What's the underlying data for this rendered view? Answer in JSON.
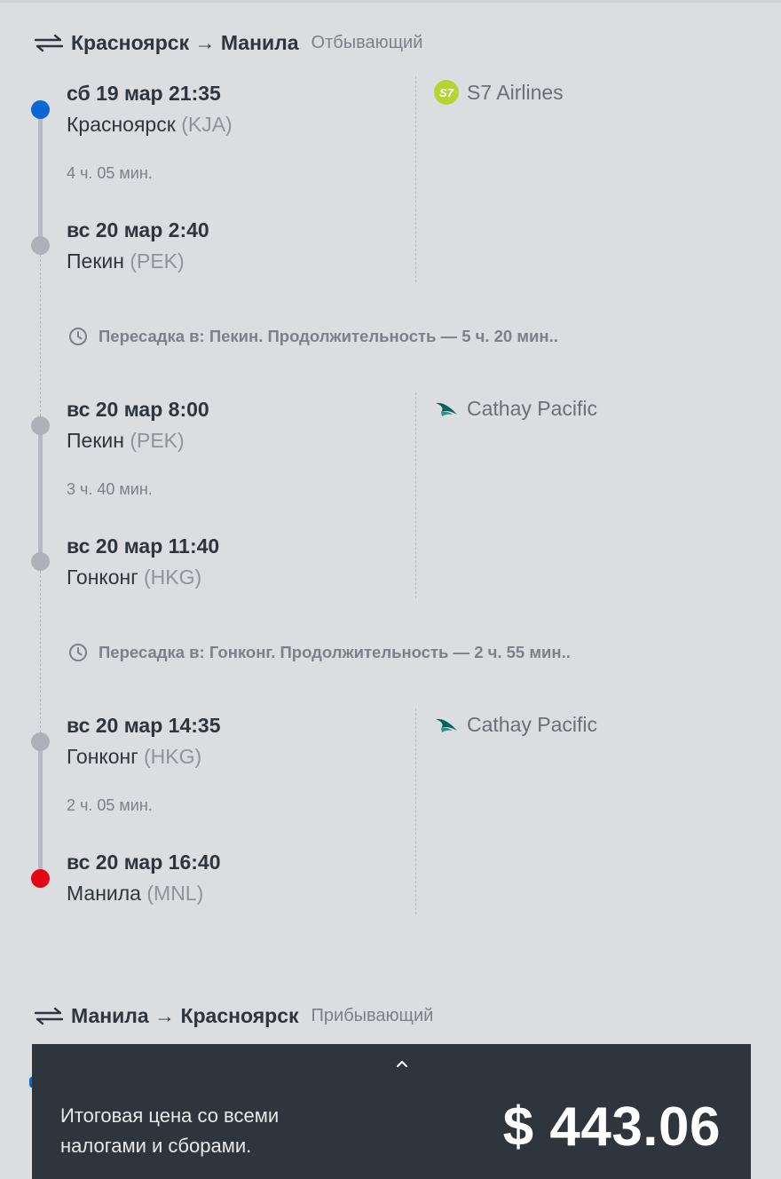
{
  "outbound": {
    "route": "Красноярск → Манила",
    "type": "Отбывающий",
    "segments": [
      {
        "airline": "S7 Airlines",
        "airline_icon": "s7-logo-icon",
        "depart": {
          "datetime": "сб 19 мар 21:35",
          "city": "Красноярск",
          "code": "(KJA)"
        },
        "duration": "4 ч. 05 мин.",
        "arrive": {
          "datetime": "вс 20 мар 2:40",
          "city": "Пекин",
          "code": "(PEK)"
        }
      },
      {
        "airline": "Cathay Pacific",
        "airline_icon": "cathay-pacific-logo-icon",
        "depart": {
          "datetime": "вс 20 мар 8:00",
          "city": "Пекин",
          "code": "(PEK)"
        },
        "duration": "3 ч. 40 мин.",
        "arrive": {
          "datetime": "вс 20 мар 11:40",
          "city": "Гонконг",
          "code": "(HKG)"
        }
      },
      {
        "airline": "Cathay Pacific",
        "airline_icon": "cathay-pacific-logo-icon",
        "depart": {
          "datetime": "вс 20 мар 14:35",
          "city": "Гонконг",
          "code": "(HKG)"
        },
        "duration": "2 ч. 05 мин.",
        "arrive": {
          "datetime": "вс 20 мар 16:40",
          "city": "Манила",
          "code": "(MNL)"
        }
      }
    ],
    "layovers": [
      "Пересадка в: Пекин. Продолжительность — 5 ч. 20 мин..",
      "Пересадка в: Гонконг. Продолжительность — 2 ч. 55 мин.."
    ]
  },
  "inbound": {
    "route": "Манила → Красноярск",
    "type": "Прибывающий"
  },
  "price": {
    "label": "Итоговая цена со всеми налогами и сборами.",
    "amount": "$ 443.06"
  },
  "colors": {
    "background": "#dcdde0",
    "panel": "#2f353d",
    "start_dot": "#0a68d4",
    "end_dot": "#e30613",
    "s7_green": "#b5d334",
    "cathay_teal": "#00645a"
  }
}
